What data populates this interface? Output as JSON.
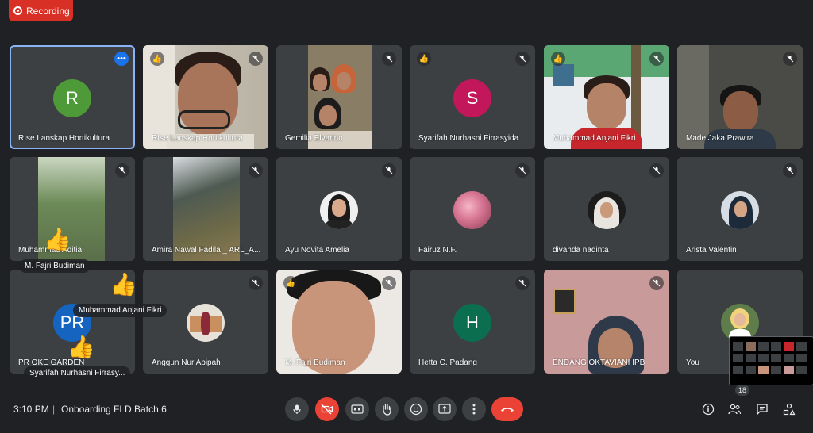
{
  "recording": {
    "label": "Recording"
  },
  "tiles": [
    {
      "name": "RIse Lanskap Hortikultura",
      "initial": "R",
      "avatar_color": "#4f9a38",
      "selected": true
    },
    {
      "name": "RIse Lanskap Hortikultura"
    },
    {
      "name": "Gemilia Elvarino"
    },
    {
      "name": "Syarifah Nurhasni Firrasyida",
      "initial": "S",
      "avatar_color": "#c2185b"
    },
    {
      "name": "Muhammad Anjani Fikri"
    },
    {
      "name": "Made Jaka Prawira"
    },
    {
      "name": "Muhammad Aditia"
    },
    {
      "name": "Amira Nawal Fadila _ ARL_A..."
    },
    {
      "name": "Ayu Novita Amelia"
    },
    {
      "name": "Fairuz N.F."
    },
    {
      "name": "divanda nadinta"
    },
    {
      "name": "Arista Valentin"
    },
    {
      "name": "PR OKE GARDEN",
      "initial": "PR",
      "avatar_color": "#1565c0"
    },
    {
      "name": "Anggun Nur Apipah"
    },
    {
      "name": "M. Fajri Budiman"
    },
    {
      "name": "Hetta C. Padang",
      "initial": "H",
      "avatar_color": "#0b6e4f"
    },
    {
      "name": "ENDANG OKTAVIANI IPB"
    },
    {
      "name": "You"
    }
  ],
  "reactions": [
    {
      "emoji": "👍",
      "name": "M. Fajri Budiman"
    },
    {
      "emoji": "👍",
      "name": "Muhammad Anjani Fikri"
    },
    {
      "emoji": "👍",
      "name": "Syarifah Nurhasni Firrasy..."
    }
  ],
  "bottom_bar": {
    "time": "3:10 PM",
    "separator": "|",
    "meeting_title": "Onboarding FLD Batch 6",
    "participant_count": "18"
  },
  "colors": {
    "background": "#202124",
    "tile": "#3c4043",
    "danger": "#ea4335",
    "accent": "#1a73e8"
  }
}
